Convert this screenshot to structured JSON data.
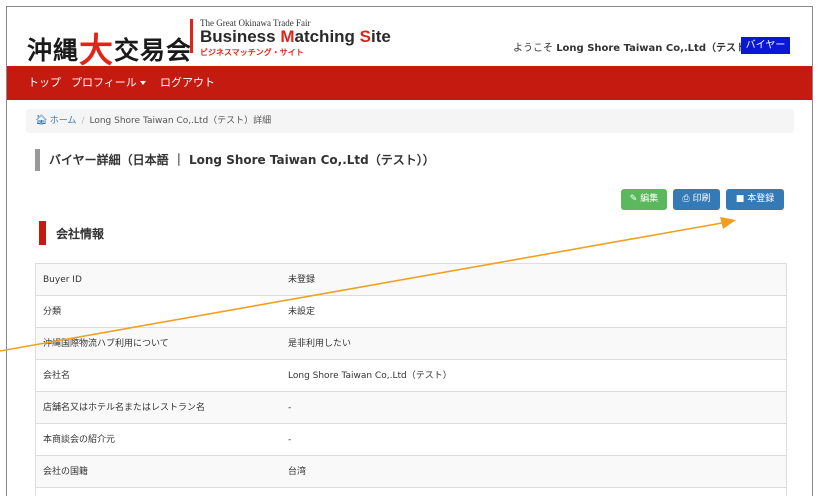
{
  "header": {
    "logo_jp": "沖縄",
    "logo_big_char": "大",
    "logo_jp_rest": "交易会",
    "logo_en_small": "The Great Okinawa Trade Fair",
    "logo_en_big_1": "Business ",
    "logo_en_big_m": "M",
    "logo_en_big_2": "atching ",
    "logo_en_big_s": "S",
    "logo_en_big_3": "ite",
    "logo_jp_small": "ビジネスマッチング・サイト",
    "welcome_prefix": "ようこそ ",
    "welcome_user": "Long Shore Taiwan Co,.Ltd（テスト）",
    "role_badge": "バイヤー"
  },
  "nav": {
    "items": [
      {
        "label": "トップ"
      },
      {
        "label": "プロフィール"
      },
      {
        "label": "ログアウト"
      }
    ]
  },
  "breadcrumb": {
    "home": "ホーム",
    "separator": "/",
    "current": "Long Shore Taiwan Co,.Ltd（テスト）詳細"
  },
  "page_title": "バイヤー詳細（日本語 ｜ Long Shore Taiwan Co,.Ltd（テスト））",
  "actions": {
    "edit": "編集",
    "print": "印刷",
    "register": "本登録"
  },
  "section_title": "会社情報",
  "company_info": [
    {
      "key": "Buyer ID",
      "value": "未登録"
    },
    {
      "key": "分類",
      "value": "未設定"
    },
    {
      "key": "沖縄国際物流ハブ利用について",
      "value": "是非利用したい"
    },
    {
      "key": "会社名",
      "value": "Long Shore Taiwan Co,.Ltd（テスト）"
    },
    {
      "key": "店舗名又はホテル名またはレストラン名",
      "value": "-"
    },
    {
      "key": "本商談会の紹介元",
      "value": "-"
    },
    {
      "key": "会社の国籍",
      "value": "台湾"
    },
    {
      "key": "",
      "value": ""
    }
  ],
  "colors": {
    "nav_red": "#c41a10",
    "badge_blue": "#0a18d6",
    "btn_green": "#5cb85c",
    "btn_blue": "#337ab7",
    "annotation_arrow": "#f0a020"
  }
}
